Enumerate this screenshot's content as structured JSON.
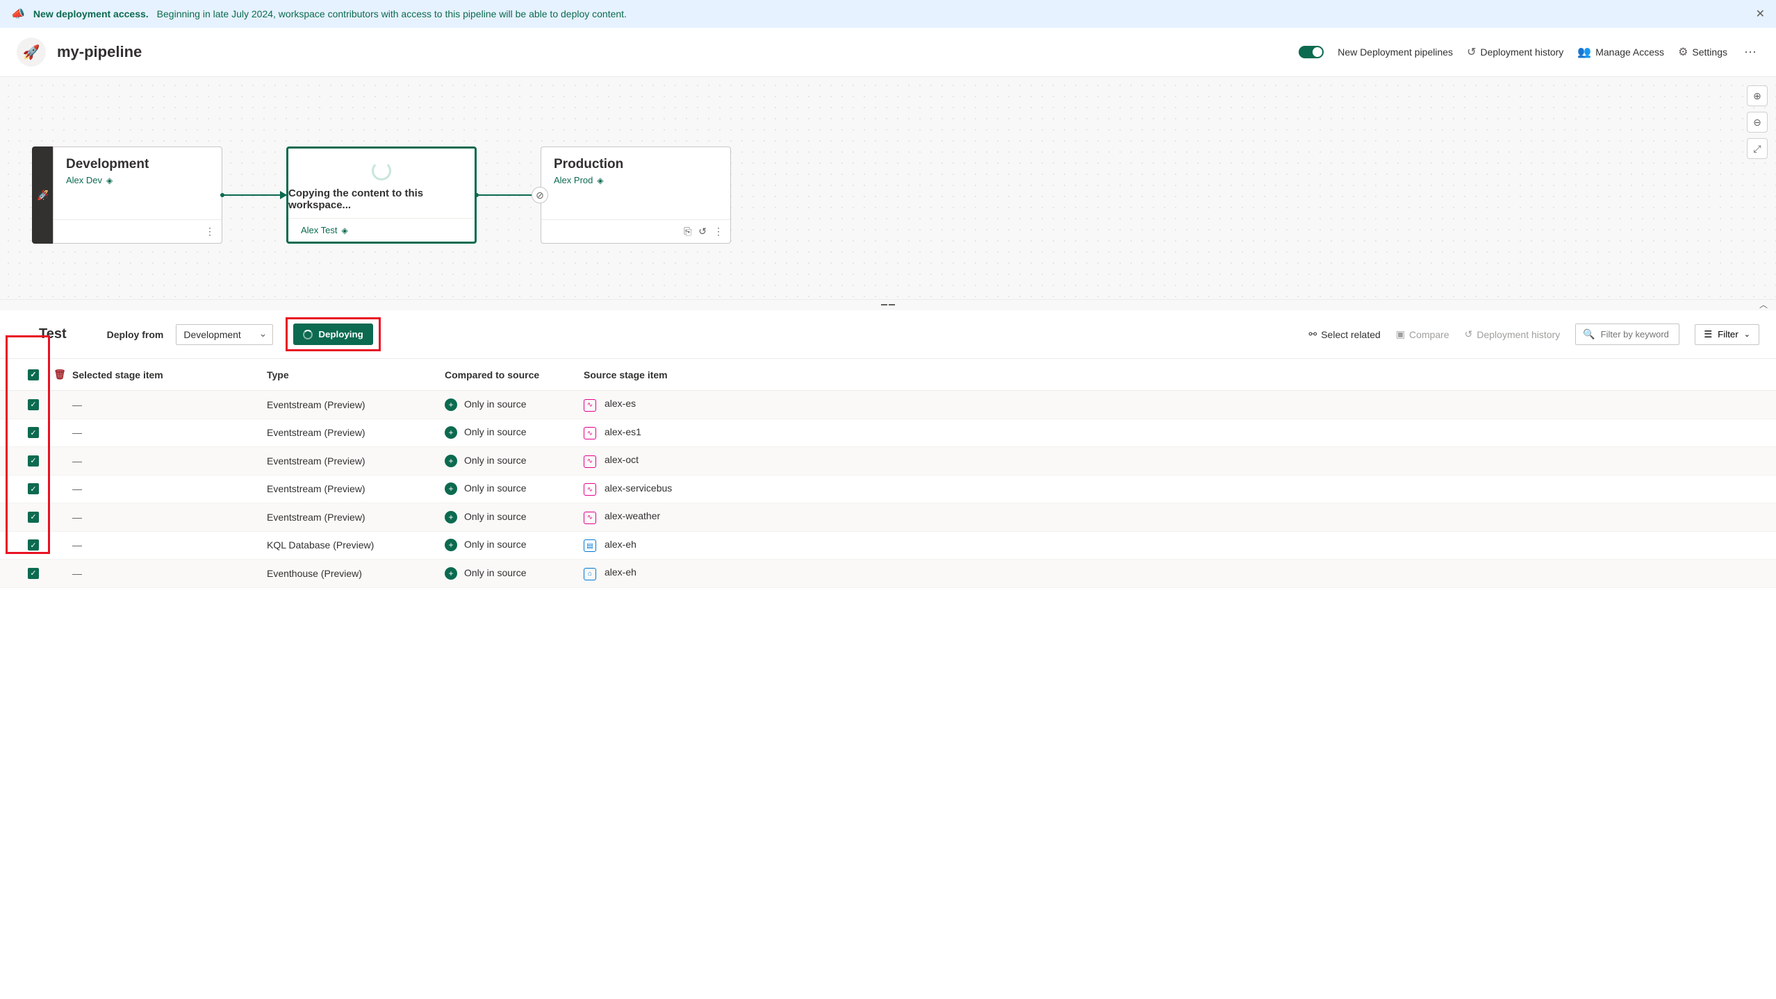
{
  "banner": {
    "title": "New deployment access.",
    "text": "Beginning in late July 2024, workspace contributors with access to this pipeline will be able to deploy content."
  },
  "header": {
    "title": "my-pipeline",
    "new_pipelines": "New Deployment pipelines",
    "history": "Deployment history",
    "manage_access": "Manage Access",
    "settings": "Settings"
  },
  "stages": {
    "dev": {
      "title": "Development",
      "sub": "Alex Dev"
    },
    "test": {
      "copying": "Copying the content to this workspace...",
      "sub": "Alex Test"
    },
    "prod": {
      "title": "Production",
      "sub": "Alex Prod"
    }
  },
  "toolbar": {
    "title": "Test",
    "deploy_from_label": "Deploy from",
    "deploy_from_value": "Development",
    "deploy_btn": "Deploying",
    "select_related": "Select related",
    "compare": "Compare",
    "history": "Deployment history",
    "search_placeholder": "Filter by keyword",
    "filter": "Filter"
  },
  "table": {
    "headers": {
      "selected": "Selected stage item",
      "type": "Type",
      "compared": "Compared to source",
      "source": "Source stage item"
    },
    "compared_label": "Only in source",
    "rows": [
      {
        "type": "Eventstream (Preview)",
        "source": "alex-es",
        "icon": "es"
      },
      {
        "type": "Eventstream (Preview)",
        "source": "alex-es1",
        "icon": "es"
      },
      {
        "type": "Eventstream (Preview)",
        "source": "alex-oct",
        "icon": "es"
      },
      {
        "type": "Eventstream (Preview)",
        "source": "alex-servicebus",
        "icon": "es"
      },
      {
        "type": "Eventstream (Preview)",
        "source": "alex-weather",
        "icon": "es"
      },
      {
        "type": "KQL Database (Preview)",
        "source": "alex-eh",
        "icon": "db"
      },
      {
        "type": "Eventhouse (Preview)",
        "source": "alex-eh",
        "icon": "eh"
      }
    ]
  }
}
